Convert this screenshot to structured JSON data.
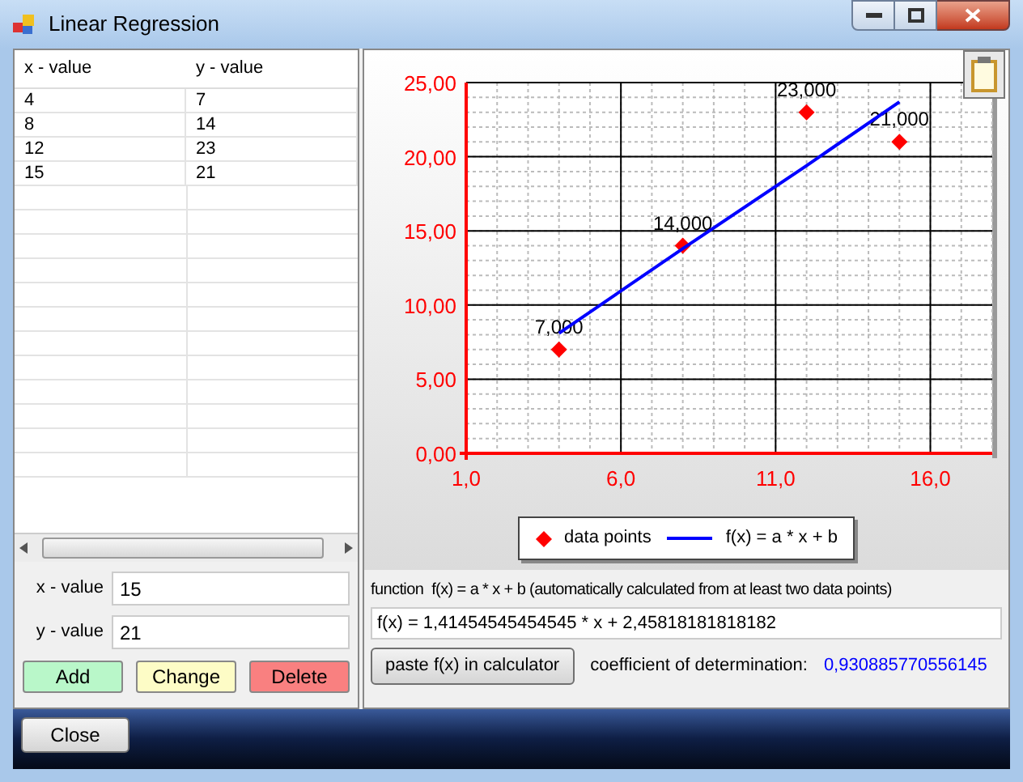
{
  "window": {
    "title": "Linear Regression"
  },
  "table": {
    "columns": [
      "x - value",
      "y - value"
    ],
    "rows": [
      [
        "4",
        "7"
      ],
      [
        "8",
        "14"
      ],
      [
        "12",
        "23"
      ],
      [
        "15",
        "21"
      ]
    ]
  },
  "inputs": [
    {
      "label": "x - value",
      "value": "15"
    },
    {
      "label": "y - value",
      "value": "21"
    }
  ],
  "buttons": [
    {
      "label": "Add",
      "color": "#b9f7c9"
    },
    {
      "label": "Change",
      "color": "#fdfcc6"
    },
    {
      "label": "Delete",
      "color": "#f98080"
    }
  ],
  "chart": {
    "chart_data": {
      "type": "scatter",
      "x": [
        4,
        8,
        12,
        15
      ],
      "series": [
        {
          "name": "data points",
          "color": "#ff0000",
          "type": "scatter",
          "values": [
            7,
            14,
            23,
            21
          ]
        },
        {
          "name": "f(x) = a * x + b",
          "color": "#0000ff",
          "type": "line",
          "values": [
            8.1,
            13.8,
            19.4,
            23.7
          ]
        }
      ],
      "value_labels": [
        "7,000",
        "14,000",
        "23,000",
        "21,000"
      ],
      "grid": true,
      "xlim": [
        1,
        18
      ],
      "ylim": [
        0,
        25
      ],
      "xticks": [
        {
          "value": 1,
          "label": "1,0"
        },
        {
          "value": 6,
          "label": "6,0"
        },
        {
          "value": 11,
          "label": "11,0"
        },
        {
          "value": 16,
          "label": "16,0"
        }
      ],
      "yticks": [
        {
          "value": 0,
          "label": "0,00"
        },
        {
          "value": 5,
          "label": "5,00"
        },
        {
          "value": 10,
          "label": "10,00"
        },
        {
          "value": 15,
          "label": "15,00"
        },
        {
          "value": 20,
          "label": "20,00"
        },
        {
          "value": 25,
          "label": "25,00"
        }
      ]
    }
  },
  "function": {
    "label": "function  f(x) = a * x + b (automatically calculated from at least two data points)",
    "value": "f(x) = 1,41454545454545 * x + 2,45818181818182",
    "button": "paste f(x) in calculator",
    "coefficient_label": "coefficient of determination:",
    "coefficient": "0,930885770556145"
  },
  "close_button": "Close"
}
